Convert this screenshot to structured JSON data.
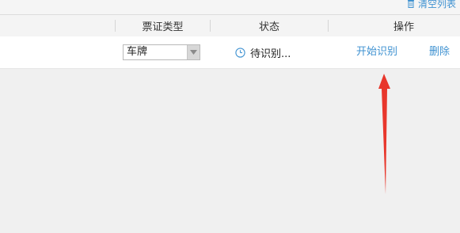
{
  "toolbar": {
    "clear_list_label": "清空列表"
  },
  "table": {
    "headers": {
      "ticket_type": "票证类型",
      "status": "状态",
      "actions": "操作"
    },
    "rows": [
      {
        "ticket_type_selected": "车牌",
        "status": "待识别...",
        "action_start": "开始识别",
        "action_delete": "删除"
      }
    ]
  },
  "colors": {
    "link": "#3f92d1",
    "annotation_arrow": "#e8372c",
    "background": "#f0f0f0"
  },
  "icons": {
    "clear_list": "trash-icon",
    "status": "clock-icon",
    "select": "dropdown-arrow-icon"
  }
}
